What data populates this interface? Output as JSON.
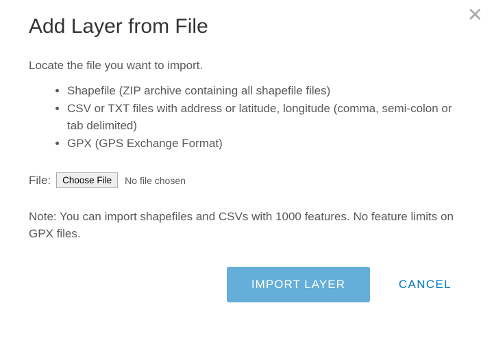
{
  "dialog": {
    "title": "Add Layer from File",
    "lead": "Locate the file you want to import.",
    "formats": [
      "Shapefile (ZIP archive containing all shapefile files)",
      "CSV or TXT files with address or latitude, longitude (comma, semi-colon or tab delimited)",
      "GPX (GPS Exchange Format)"
    ],
    "file": {
      "label": "File:",
      "choose_button": "Choose File",
      "status": "No file chosen"
    },
    "note": "Note: You can import shapefiles and CSVs with 1000 features. No feature limits on GPX files.",
    "actions": {
      "import": "IMPORT LAYER",
      "cancel": "CANCEL"
    }
  }
}
